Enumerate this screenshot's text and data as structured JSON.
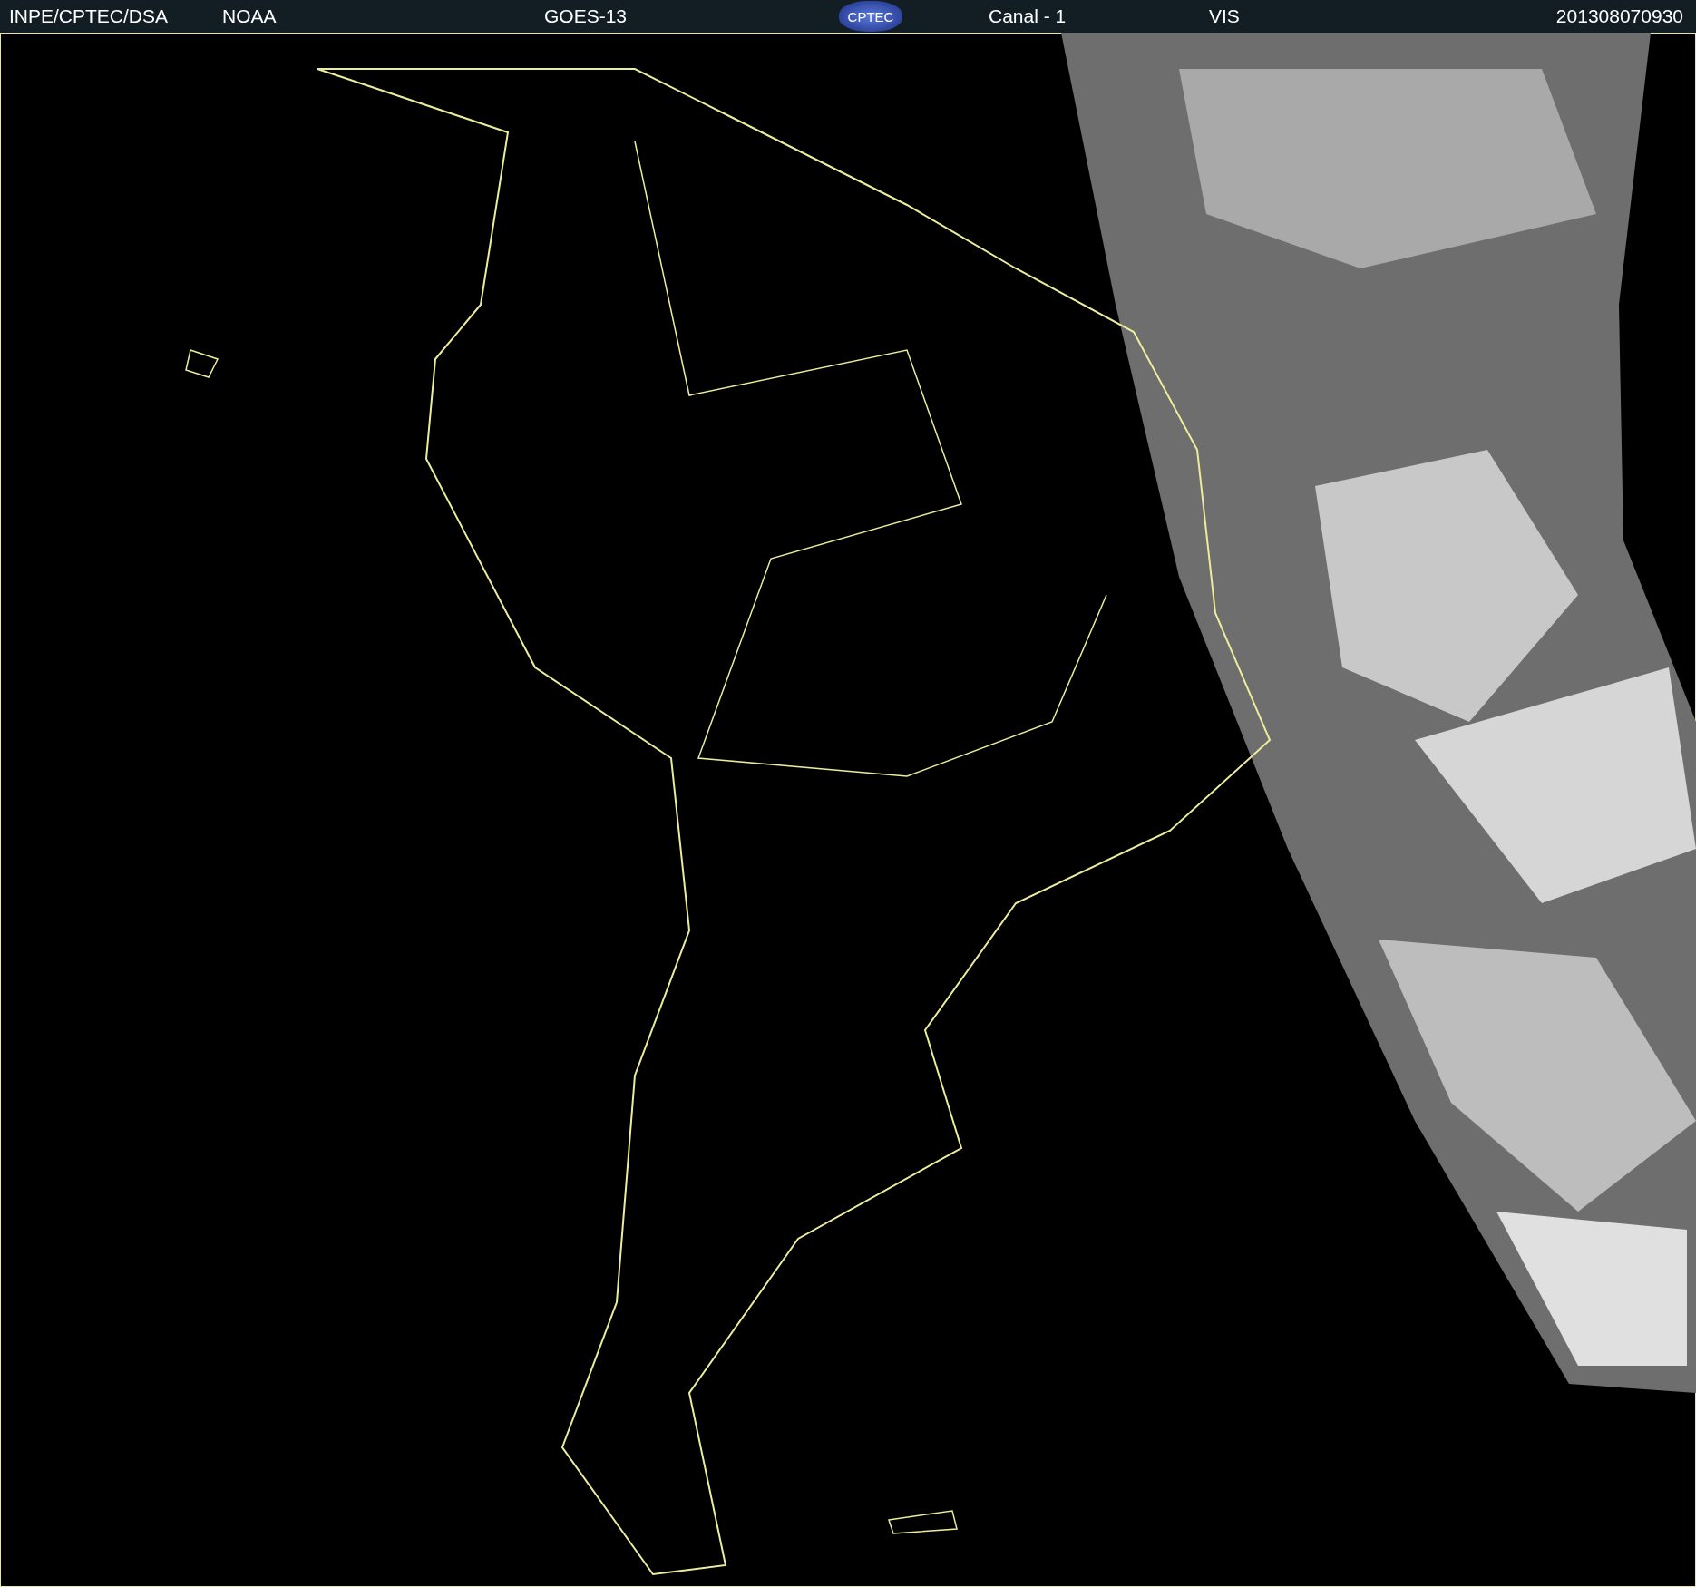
{
  "header": {
    "institution": "INPE/CPTEC/DSA",
    "agency": "NOAA",
    "satellite": "GOES-13",
    "logo": "CPTEC",
    "channel": "Canal - 1",
    "band": "VIS",
    "timestamp": "201308070930"
  }
}
